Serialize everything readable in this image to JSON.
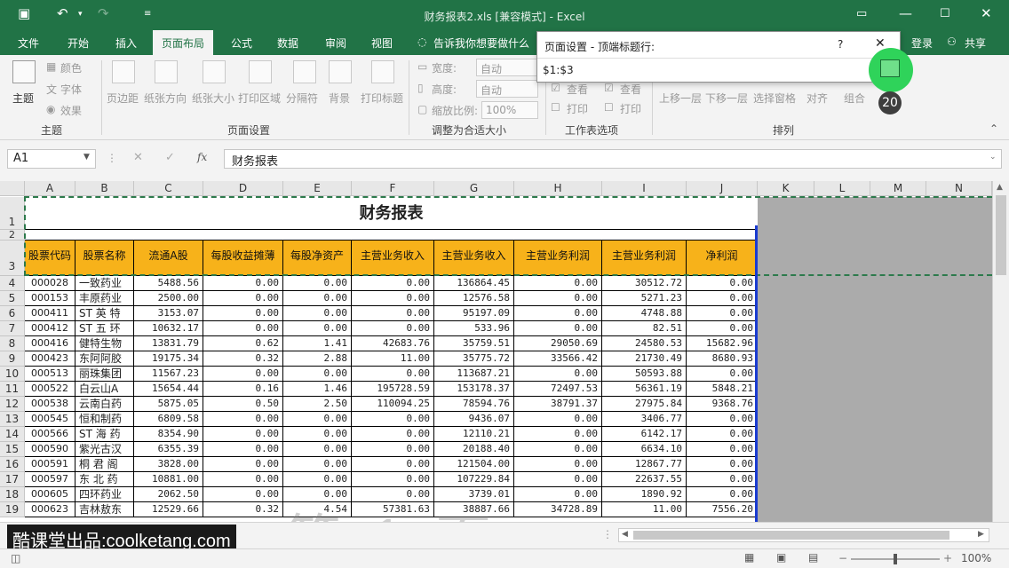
{
  "window": {
    "title": "财务报表2.xls  [兼容模式] - Excel"
  },
  "tabs": [
    "文件",
    "开始",
    "插入",
    "页面布局",
    "公式",
    "数据",
    "审阅",
    "视图"
  ],
  "tell_me": "告诉我你想要做什么",
  "account": {
    "login": "登录",
    "share": "共享"
  },
  "ribbon": {
    "theme": {
      "themes": "主题",
      "colors": "颜色",
      "fonts": "字体",
      "effects": "效果",
      "group": "主题"
    },
    "page_setup": {
      "margins": "页边距",
      "orientation": "纸张方向",
      "size": "纸张大小",
      "print_area": "打印区域",
      "breaks": "分隔符",
      "background": "背景",
      "print_titles": "打印标题",
      "group": "页面设置"
    },
    "scale": {
      "width_label": "宽度:",
      "width_value": "自动",
      "height_label": "高度:",
      "height_value": "自动",
      "scale_label": "缩放比例:",
      "scale_value": "100%",
      "group": "调整为合适大小"
    },
    "sheet_options": {
      "view1": "查看",
      "print1": "打印",
      "view2": "查看",
      "print2": "打印",
      "group": "工作表选项"
    },
    "arrange": {
      "forward": "上移一层",
      "backward": "下移一层",
      "selection_pane": "选择窗格",
      "align": "对齐",
      "group_btn": "组合",
      "group": "排列"
    }
  },
  "dialog": {
    "title": "页面设置 - 顶端标题行:",
    "help": "?",
    "value": "$1:$3"
  },
  "step_badge": "20",
  "formula_bar": {
    "name_box": "A1",
    "fx": "fx",
    "content": "财务报表"
  },
  "columns": [
    "A",
    "B",
    "C",
    "D",
    "E",
    "F",
    "G",
    "H",
    "I",
    "J",
    "K",
    "L",
    "M",
    "N"
  ],
  "sheet": {
    "title": "财务报表",
    "headers": [
      "股票代码",
      "股票名称",
      "流通A股",
      "每股收益摊薄",
      "每股净资产",
      "主营业务收入",
      "主营业务收入",
      "主营业务利润",
      "主营业务利润",
      "净利润"
    ],
    "rows": [
      [
        "000028",
        "一致药业",
        "5488.56",
        "0.00",
        "0.00",
        "0.00",
        "136864.45",
        "0.00",
        "30512.72",
        "0.00"
      ],
      [
        "000153",
        "丰原药业",
        "2500.00",
        "0.00",
        "0.00",
        "0.00",
        "12576.58",
        "0.00",
        "5271.23",
        "0.00"
      ],
      [
        "000411",
        "ST 英 特",
        "3153.07",
        "0.00",
        "0.00",
        "0.00",
        "95197.09",
        "0.00",
        "4748.88",
        "0.00"
      ],
      [
        "000412",
        "ST 五 环",
        "10632.17",
        "0.00",
        "0.00",
        "0.00",
        "533.96",
        "0.00",
        "82.51",
        "0.00"
      ],
      [
        "000416",
        "健特生物",
        "13831.79",
        "0.62",
        "1.41",
        "42683.76",
        "35759.51",
        "29050.69",
        "24580.53",
        "15682.96"
      ],
      [
        "000423",
        "东阿阿胶",
        "19175.34",
        "0.32",
        "2.88",
        "11.00",
        "35775.72",
        "33566.42",
        "21730.49",
        "8680.93"
      ],
      [
        "000513",
        "丽珠集团",
        "11567.23",
        "0.00",
        "0.00",
        "0.00",
        "113687.21",
        "0.00",
        "50593.88",
        "0.00"
      ],
      [
        "000522",
        "白云山A",
        "15654.44",
        "0.16",
        "1.46",
        "195728.59",
        "153178.37",
        "72497.53",
        "56361.19",
        "5848.21"
      ],
      [
        "000538",
        "云南白药",
        "5875.05",
        "0.50",
        "2.50",
        "110094.25",
        "78594.76",
        "38791.37",
        "27975.84",
        "9368.76"
      ],
      [
        "000545",
        "恒和制药",
        "6809.58",
        "0.00",
        "0.00",
        "0.00",
        "9436.07",
        "0.00",
        "3406.77",
        "0.00"
      ],
      [
        "000566",
        "ST 海 药",
        "8354.90",
        "0.00",
        "0.00",
        "0.00",
        "12110.21",
        "0.00",
        "6142.17",
        "0.00"
      ],
      [
        "000590",
        "紫光古汉",
        "6355.39",
        "0.00",
        "0.00",
        "0.00",
        "20188.40",
        "0.00",
        "6634.10",
        "0.00"
      ],
      [
        "000591",
        "桐 君 阁",
        "3828.00",
        "0.00",
        "0.00",
        "0.00",
        "121504.00",
        "0.00",
        "12867.77",
        "0.00"
      ],
      [
        "000597",
        "东 北 药",
        "10881.00",
        "0.00",
        "0.00",
        "0.00",
        "107229.84",
        "0.00",
        "22637.55",
        "0.00"
      ],
      [
        "000605",
        "四环药业",
        "2062.50",
        "0.00",
        "0.00",
        "0.00",
        "3739.01",
        "0.00",
        "1890.92",
        "0.00"
      ],
      [
        "000623",
        "吉林敖东",
        "12529.66",
        "0.32",
        "4.54",
        "57381.63",
        "38887.66",
        "34728.89",
        "11.00",
        "7556.20"
      ]
    ]
  },
  "row_numbers": [
    "1",
    "2",
    "3",
    "4",
    "5",
    "6",
    "7",
    "8",
    "9",
    "10",
    "11",
    "12",
    "13",
    "14",
    "15",
    "16",
    "17",
    "18",
    "19"
  ],
  "watermark": "第 1 页",
  "banner": "酷课堂出品:coolketang.com",
  "status": {
    "zoom": "100%"
  }
}
